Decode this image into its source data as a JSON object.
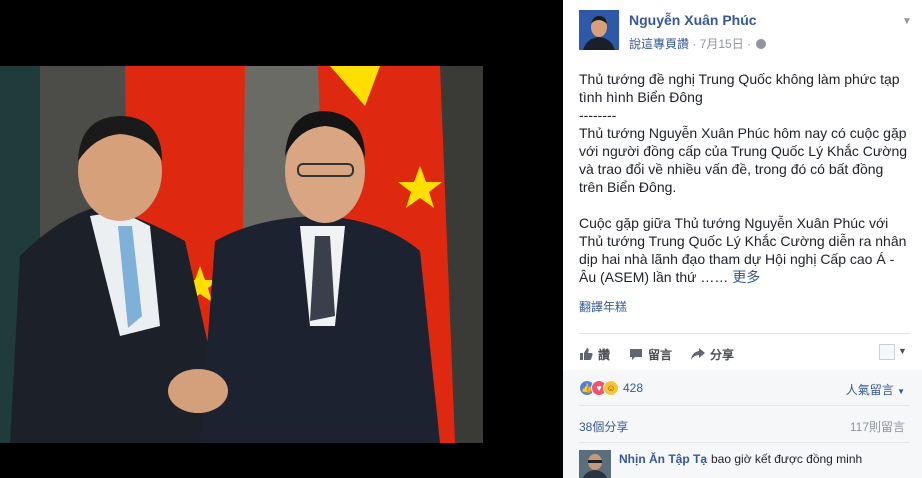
{
  "post": {
    "author": "Nguyễn Xuân Phúc",
    "liked_label": "說這專頁讚",
    "date": "7月15日",
    "body": [
      "Thủ tướng đề nghị Trung Quốc không làm phức tạp tình hình Biển Đông",
      "--------",
      "Thủ tướng Nguyễn Xuân Phúc hôm nay có cuộc gặp với người đồng cấp của Trung Quốc Lý Khắc Cường và trao đổi về nhiều vấn đề, trong đó có bất đồng trên Biển Đông.",
      "Cuộc gặp giữa Thủ tướng Nguyễn Xuân Phúc với Thủ tướng Trung Quốc Lý Khắc Cường diễn ra nhân dịp hai nhà lãnh đạo tham dự Hội nghị Cấp cao Á - Âu (ASEM) lần thứ ……"
    ],
    "more_label": "更多",
    "translate_label": "翻譯年糕"
  },
  "actions": {
    "like": "讚",
    "comment": "留言",
    "share": "分享"
  },
  "stats": {
    "reaction_count": "428",
    "sort_label": "人氣留言",
    "shares": "38個分享",
    "comments": "117則留言"
  },
  "comment": {
    "name": "Nhịn Ăn Tập Tạ",
    "text": "bao giờ kết được đồng minh"
  },
  "icons": {
    "like": "thumbs-up-icon",
    "comment": "speech-bubble-icon",
    "share": "share-arrow-icon",
    "audience": "globe-icon",
    "options": "chevron-down-icon"
  },
  "colors": {
    "link": "#365899",
    "flag_red": "#de2910",
    "flag_yellow": "#ffde00"
  }
}
